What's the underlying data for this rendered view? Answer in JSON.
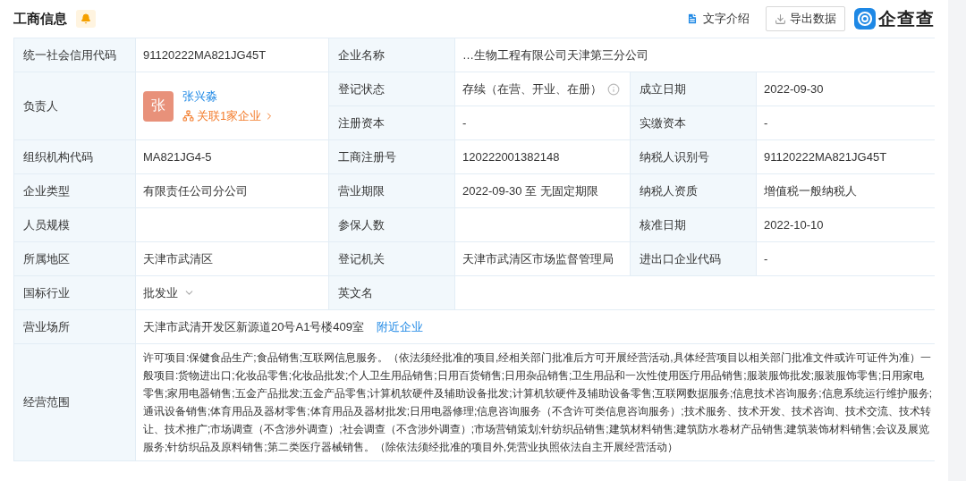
{
  "header": {
    "title": "工商信息",
    "actions": [
      {
        "kind": "doc",
        "label": "文字介绍"
      },
      {
        "kind": "export",
        "label": "导出数据"
      }
    ],
    "logo": "企查查"
  },
  "table": [
    {
      "kind": "row",
      "pairs": [
        {
          "kind": "text",
          "label": "统一社会信用代码",
          "value": "91120222MA821JG45T"
        },
        {
          "kind": "text",
          "label": "企业名称",
          "value": "…生物工程有限公司天津第三分公司"
        }
      ]
    },
    {
      "kind": "person_group",
      "person": {
        "label": "负责人",
        "avatar": "张",
        "name": "张兴淼",
        "link": "关联1家企业"
      },
      "rows": [
        [
          {
            "kind": "status",
            "label": "登记状态",
            "value": "存续（在营、开业、在册）"
          },
          {
            "kind": "text",
            "label": "成立日期",
            "value": "2022-09-30"
          }
        ],
        [
          {
            "kind": "text",
            "label": "注册资本",
            "value": "-"
          },
          {
            "kind": "text",
            "label": "实缴资本",
            "value": "-"
          }
        ]
      ]
    },
    {
      "kind": "row",
      "pairs": [
        {
          "kind": "text",
          "label": "组织机构代码",
          "value": "MA821JG4-5"
        },
        {
          "kind": "text",
          "label": "工商注册号",
          "value": "120222001382148"
        },
        {
          "kind": "text",
          "label": "纳税人识别号",
          "value": "91120222MA821JG45T"
        }
      ]
    },
    {
      "kind": "row",
      "pairs": [
        {
          "kind": "text",
          "label": "企业类型",
          "value": "有限责任公司分公司"
        },
        {
          "kind": "text",
          "label": "营业期限",
          "value": "2022-09-30 至 无固定期限"
        },
        {
          "kind": "text",
          "label": "纳税人资质",
          "value": "增值税一般纳税人"
        }
      ]
    },
    {
      "kind": "row",
      "pairs": [
        {
          "kind": "text",
          "label": "人员规模"
        },
        {
          "kind": "text",
          "label": "参保人数"
        },
        {
          "kind": "text",
          "label": "核准日期",
          "value": "2022-10-10"
        }
      ]
    },
    {
      "kind": "row",
      "pairs": [
        {
          "kind": "text",
          "label": "所属地区",
          "value": "天津市武清区"
        },
        {
          "kind": "text",
          "label": "登记机关",
          "value": "天津市武清区市场监督管理局"
        },
        {
          "kind": "text",
          "label": "进出口企业代码",
          "value": "-"
        }
      ]
    },
    {
      "kind": "row",
      "pairs": [
        {
          "kind": "industry",
          "label": "国标行业",
          "value": "批发业"
        },
        {
          "kind": "text",
          "label": "英文名"
        }
      ]
    },
    {
      "kind": "row",
      "pairs": [
        {
          "kind": "address",
          "label": "营业场所",
          "value": "天津市武清开发区新源道20号A1号楼409室",
          "link": "附近企业"
        }
      ]
    },
    {
      "kind": "scope",
      "pairs": [
        {
          "label": "经营范围",
          "value": "许可项目:保健食品生产;食品销售;互联网信息服务。（依法须经批准的项目,经相关部门批准后方可开展经营活动,具体经营项目以相关部门批准文件或许可证件为准）一般项目:货物进出口;化妆品零售;化妆品批发;个人卫生用品销售;日用百货销售;日用杂品销售;卫生用品和一次性使用医疗用品销售;服装服饰批发;服装服饰零售;日用家电零售;家用电器销售;五金产品批发;五金产品零售;计算机软硬件及辅助设备批发;计算机软硬件及辅助设备零售;互联网数据服务;信息技术咨询服务;信息系统运行维护服务;通讯设备销售;体育用品及器材零售;体育用品及器材批发;日用电器修理;信息咨询服务（不含许可类信息咨询服务）;技术服务、技术开发、技术咨询、技术交流、技术转让、技术推广;市场调查（不含涉外调查）;社会调查（不含涉外调查）;市场营销策划;针纺织品销售;建筑材料销售;建筑防水卷材产品销售;建筑装饰材料销售;会议及展览服务;针纺织品及原料销售;第二类医疗器械销售。（除依法须经批准的项目外,凭营业执照依法自主开展经营活动）"
        }
      ]
    }
  ]
}
